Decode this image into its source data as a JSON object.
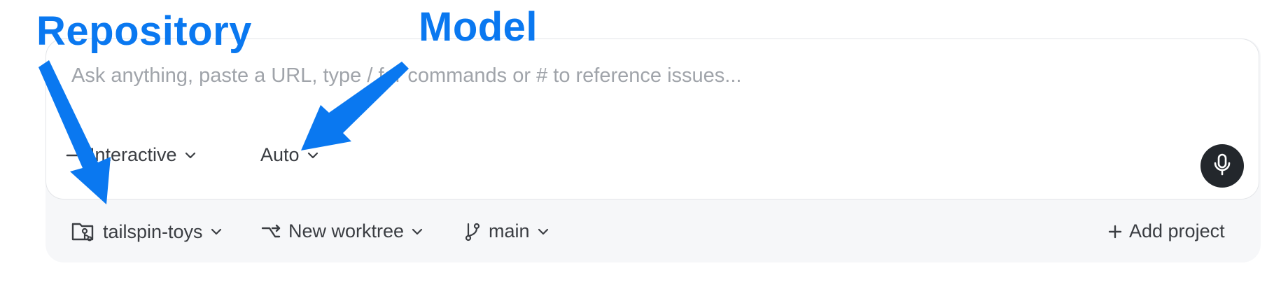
{
  "composer": {
    "placeholder": "Ask anything, paste a URL, type / for commands or # to reference issues...",
    "mode_label": "Interactive",
    "model_label": "Auto"
  },
  "footer": {
    "repository_label": "tailspin-toys",
    "worktree_label": "New worktree",
    "branch_label": "main",
    "add_project_label": "Add project"
  },
  "annotations": {
    "repository": "Repository",
    "model": "Model"
  },
  "colors": {
    "annotation": "#0a78f0",
    "mic_button": "#23272c",
    "footer_bg": "#f6f7f9"
  },
  "icons": {
    "mode": "chevron-down-icon",
    "repository": "folder-git-icon",
    "worktree": "worktree-icon",
    "branch": "git-branch-icon",
    "add": "plus-icon",
    "mic": "microphone-icon"
  }
}
